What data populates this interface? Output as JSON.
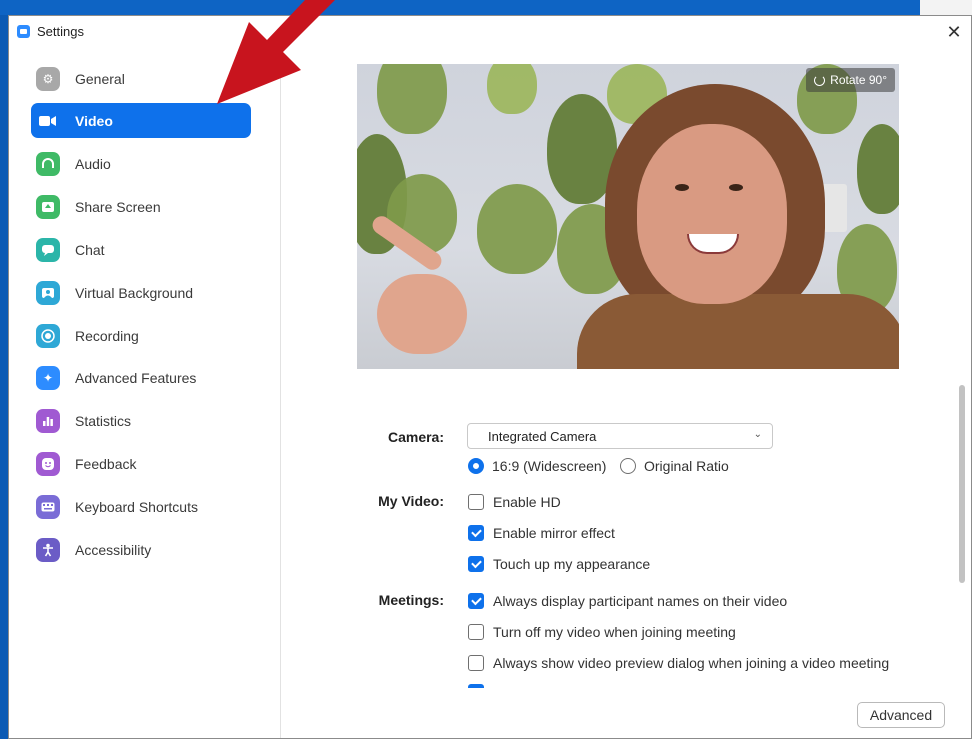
{
  "window": {
    "title": "Settings",
    "close_icon": "close-icon"
  },
  "colors": {
    "accent": "#0e71eb",
    "sidebar_active": "#0e71eb",
    "annotation_arrow": "#c8141e"
  },
  "sidebar": {
    "items": [
      {
        "label": "General",
        "icon": "gear-icon",
        "color": "#a8a8a8",
        "active": false
      },
      {
        "label": "Video",
        "icon": "video-camera-icon",
        "color": "#0e71eb",
        "active": true
      },
      {
        "label": "Audio",
        "icon": "headphones-icon",
        "color": "#3fba66",
        "active": false
      },
      {
        "label": "Share Screen",
        "icon": "share-screen-icon",
        "color": "#3fba66",
        "active": false
      },
      {
        "label": "Chat",
        "icon": "chat-icon",
        "color": "#2bb5a9",
        "active": false
      },
      {
        "label": "Virtual Background",
        "icon": "virtual-background-icon",
        "color": "#2ea8d6",
        "active": false
      },
      {
        "label": "Recording",
        "icon": "recording-icon",
        "color": "#2ea8d6",
        "active": false
      },
      {
        "label": "Advanced Features",
        "icon": "sparkle-icon",
        "color": "#2d8cff",
        "active": false
      },
      {
        "label": "Statistics",
        "icon": "bar-chart-icon",
        "color": "#a05ad2",
        "active": false
      },
      {
        "label": "Feedback",
        "icon": "smiley-icon",
        "color": "#a05ad2",
        "active": false
      },
      {
        "label": "Keyboard Shortcuts",
        "icon": "keyboard-icon",
        "color": "#7a6cd6",
        "active": false
      },
      {
        "label": "Accessibility",
        "icon": "accessibility-icon",
        "color": "#6b5cc6",
        "active": false
      }
    ]
  },
  "preview": {
    "rotate_label": "Rotate 90°"
  },
  "camera": {
    "label": "Camera:",
    "selected": "Integrated Camera",
    "ratio_options": [
      {
        "label": "16:9 (Widescreen)",
        "selected": true
      },
      {
        "label": "Original Ratio",
        "selected": false
      }
    ]
  },
  "my_video": {
    "label": "My Video:",
    "options": [
      {
        "label": "Enable HD",
        "checked": false
      },
      {
        "label": "Enable mirror effect",
        "checked": true
      },
      {
        "label": "Touch up my appearance",
        "checked": true
      }
    ]
  },
  "meetings": {
    "label": "Meetings:",
    "options": [
      {
        "label": "Always display participant names on their video",
        "checked": true
      },
      {
        "label": "Turn off my video when joining meeting",
        "checked": false
      },
      {
        "label": "Always show video preview dialog when joining a video meeting",
        "checked": false
      }
    ],
    "partial_option": {
      "checked": true
    }
  },
  "advanced_button": "Advanced"
}
